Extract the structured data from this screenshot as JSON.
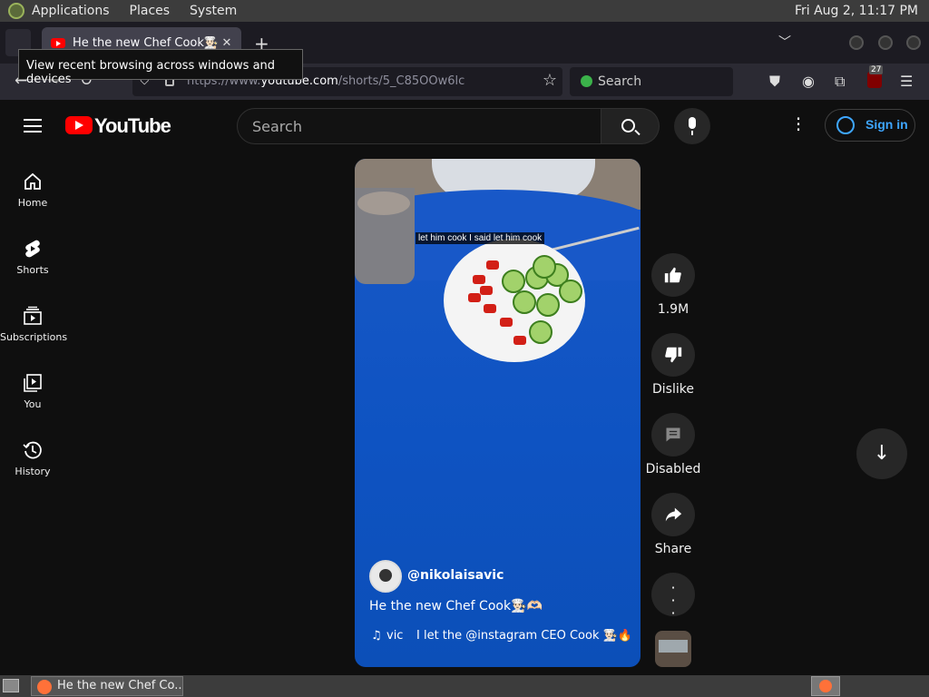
{
  "os": {
    "menus": [
      "Applications",
      "Places",
      "System"
    ],
    "clock": "Fri Aug  2, 11:17 PM"
  },
  "browser": {
    "tab_title": "He the new Chef Cook👨🏻‍🍳🫶🏻",
    "tooltip": "View recent browsing across windows and devices",
    "url_prefix": "https://www.",
    "url_host": "youtube.com",
    "url_path": "/shorts/5_C85OOw6lc",
    "search_placeholder": "Search",
    "ublock_badge": "27"
  },
  "youtube": {
    "logo_text": "YouTube",
    "search_placeholder": "Search",
    "signin_label": "Sign in",
    "guide": [
      {
        "label": "Home",
        "icon": "home-icon"
      },
      {
        "label": "Shorts",
        "icon": "shorts-icon"
      },
      {
        "label": "Subscriptions",
        "icon": "subscriptions-icon"
      },
      {
        "label": "You",
        "icon": "you-icon"
      },
      {
        "label": "History",
        "icon": "history-icon"
      }
    ],
    "short": {
      "caption": "let him cook I said let him cook",
      "channel": "@nikolaisavic",
      "title": "He the new Chef Cook👨🏻‍🍳🫶🏻",
      "music_artist": "vic",
      "music_track": "I let the @instagram CEO Cook 👨🏻‍🍳🔥 #"
    },
    "actions": {
      "likes": "1.9M",
      "dislike": "Dislike",
      "comments": "Disabled",
      "share": "Share"
    }
  },
  "taskbar": {
    "window_title": "He the new Chef Co..."
  }
}
